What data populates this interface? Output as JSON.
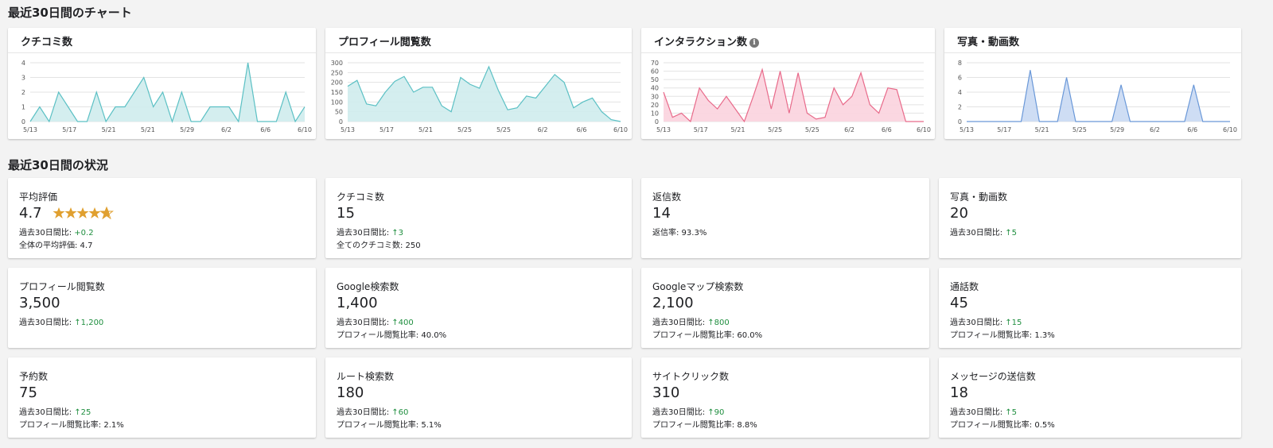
{
  "sections": {
    "charts_title": "最近30日間のチャート",
    "status_title": "最近30日間の状況"
  },
  "colors": {
    "teal": "#5bc0c4",
    "teal_fill": "#cfeced",
    "pink": "#e86a8a",
    "pink_fill": "#fbd3de",
    "blue": "#6a98d8",
    "blue_fill": "#c9d9f3",
    "green": "#1e8e3e",
    "star": "#e0a030"
  },
  "chart_data": [
    {
      "type": "area",
      "title": "クチコミ数",
      "x_ticks": [
        "5/13",
        "5/17",
        "5/21",
        "5/21",
        "5/29",
        "6/2",
        "6/6",
        "6/10"
      ],
      "y_ticks": [
        "0",
        "1",
        "2",
        "3",
        "4"
      ],
      "ylim": [
        0,
        4
      ],
      "values": [
        0,
        1,
        0,
        2,
        1,
        0,
        0,
        2,
        0,
        1,
        1,
        2,
        3,
        1,
        2,
        0,
        2,
        0,
        0,
        1,
        1,
        1,
        0,
        4,
        0,
        0,
        0,
        2,
        0,
        1
      ]
    },
    {
      "type": "area",
      "title": "プロフィール閲覧数",
      "x_ticks": [
        "5/13",
        "5/17",
        "5/21",
        "5/25",
        "5/25",
        "6/2",
        "6/6",
        "6/10"
      ],
      "y_ticks": [
        "0",
        "50",
        "100",
        "150",
        "200",
        "250",
        "300"
      ],
      "ylim": [
        0,
        300
      ],
      "values": [
        180,
        210,
        90,
        80,
        150,
        205,
        230,
        150,
        175,
        175,
        80,
        50,
        225,
        190,
        170,
        280,
        160,
        60,
        70,
        130,
        120,
        180,
        240,
        200,
        70,
        100,
        120,
        50,
        10,
        0
      ]
    },
    {
      "type": "area",
      "title": "インタラクション数",
      "x_ticks": [
        "5/13",
        "5/17",
        "5/21",
        "5/25",
        "5/25",
        "6/2",
        "6/6",
        "6/10"
      ],
      "y_ticks": [
        "0",
        "10",
        "20",
        "30",
        "40",
        "50",
        "60",
        "70"
      ],
      "ylim": [
        0,
        70
      ],
      "values": [
        35,
        5,
        10,
        0,
        40,
        25,
        15,
        30,
        15,
        0,
        30,
        62,
        15,
        60,
        10,
        58,
        10,
        3,
        5,
        40,
        20,
        30,
        58,
        20,
        10,
        40,
        38,
        0,
        0,
        0
      ]
    },
    {
      "type": "area",
      "title": "写真・動画数",
      "x_ticks": [
        "5/13",
        "5/17",
        "5/21",
        "5/25",
        "5/29",
        "6/2",
        "6/6",
        "6/10"
      ],
      "y_ticks": [
        "0",
        "2",
        "4",
        "6",
        "8"
      ],
      "ylim": [
        0,
        8
      ],
      "values": [
        0,
        0,
        0,
        0,
        0,
        0,
        0,
        7,
        0,
        0,
        0,
        6,
        0,
        0,
        0,
        0,
        0,
        5,
        0,
        0,
        0,
        0,
        0,
        0,
        0,
        5,
        0,
        0,
        0,
        0
      ]
    }
  ],
  "stats": [
    {
      "label": "平均評価",
      "value": "4.7",
      "line1_prefix": "過去30日間比: ",
      "line1_delta": "+0.2",
      "line2": "全体の平均評価: 4.7",
      "rating": 4.7
    },
    {
      "label": "クチコミ数",
      "value": "15",
      "line1_prefix": "過去30日間比: ",
      "line1_delta": "↑3",
      "line2": "全てのクチコミ数: 250"
    },
    {
      "label": "返信数",
      "value": "14",
      "line1_prefix": "返信率: 93.3%",
      "line1_delta": "",
      "line2": ""
    },
    {
      "label": "写真・動画数",
      "value": "20",
      "line1_prefix": "過去30日間比: ",
      "line1_delta": "↑5",
      "line2": ""
    },
    {
      "label": "プロフィール閲覧数",
      "value": "3,500",
      "line1_prefix": "過去30日間比: ",
      "line1_delta": "↑1,200",
      "line2": ""
    },
    {
      "label": "Google検索数",
      "value": "1,400",
      "line1_prefix": "過去30日間比: ",
      "line1_delta": "↑400",
      "line2": "プロフィール閲覧比率: 40.0%"
    },
    {
      "label": "Googleマップ検索数",
      "value": "2,100",
      "line1_prefix": "過去30日間比: ",
      "line1_delta": "↑800",
      "line2": "プロフィール閲覧比率: 60.0%"
    },
    {
      "label": "通話数",
      "value": "45",
      "line1_prefix": "過去30日間比: ",
      "line1_delta": "↑15",
      "line2": "プロフィール閲覧比率: 1.3%"
    },
    {
      "label": "予約数",
      "value": "75",
      "line1_prefix": "過去30日間比: ",
      "line1_delta": "↑25",
      "line2": "プロフィール閲覧比率: 2.1%"
    },
    {
      "label": "ルート検索数",
      "value": "180",
      "line1_prefix": "過去30日間比: ",
      "line1_delta": "↑60",
      "line2": "プロフィール閲覧比率: 5.1%"
    },
    {
      "label": "サイトクリック数",
      "value": "310",
      "line1_prefix": "過去30日間比: ",
      "line1_delta": "↑90",
      "line2": "プロフィール閲覧比率: 8.8%"
    },
    {
      "label": "メッセージの送信数",
      "value": "18",
      "line1_prefix": "過去30日間比: ",
      "line1_delta": "↑5",
      "line2": "プロフィール閲覧比率: 0.5%"
    }
  ]
}
